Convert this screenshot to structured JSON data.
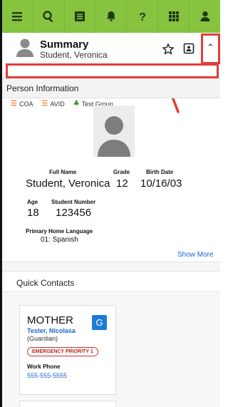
{
  "nav": {
    "items": [
      {
        "icon": "menu-icon"
      },
      {
        "icon": "search-icon"
      },
      {
        "icon": "list-icon"
      },
      {
        "icon": "bell-icon"
      },
      {
        "icon": "help-icon"
      },
      {
        "icon": "grid-icon"
      },
      {
        "icon": "user-icon"
      }
    ],
    "color": "#86c440"
  },
  "summary": {
    "title": "Summary",
    "student_name": "Student, Veronica",
    "chips": [
      {
        "icon": "list-icon",
        "label": "COA"
      },
      {
        "icon": "list-icon",
        "label": "AVID"
      },
      {
        "icon": "group-icon",
        "label": "Test Group"
      }
    ]
  },
  "person_info": {
    "title": "Person Information",
    "full_name_label": "Full Name",
    "full_name": "Student, Veronica",
    "grade_label": "Grade",
    "grade": "12",
    "birth_date_label": "Birth Date",
    "birth_date": "10/16/03",
    "age_label": "Age",
    "age": "18",
    "student_number_label": "Student Number",
    "student_number": "123456",
    "language_label": "Primary Home Language",
    "language": "01: Spanish",
    "show_more": "Show More"
  },
  "quick_contacts": {
    "title": "Quick Contacts",
    "contacts": [
      {
        "relationship": "MOTHER",
        "badge": "G",
        "name": "Tester, Nicolasa",
        "role": "(Guardian)",
        "priority": "EMERGENCY PRIORITY 1",
        "work_phone_label": "Work Phone",
        "work_phone": "555-555-5555"
      }
    ]
  },
  "annotation_color": "#e23c3c"
}
